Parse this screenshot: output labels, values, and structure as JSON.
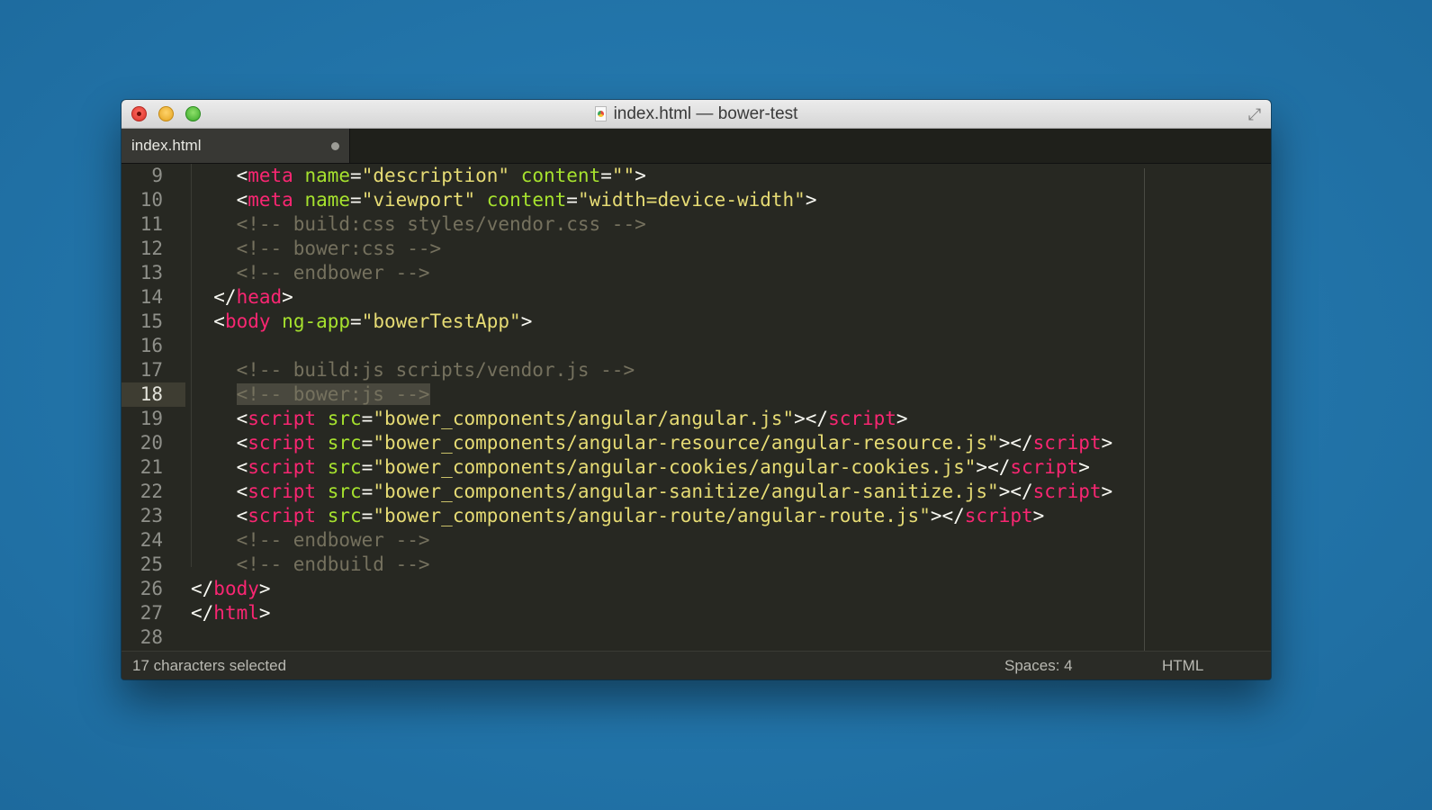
{
  "window": {
    "title": "index.html — bower-test"
  },
  "tabs": [
    {
      "label": "index.html",
      "modified": true
    }
  ],
  "editor": {
    "active_line": 18,
    "lines": [
      {
        "n": "9",
        "tokens": [
          [
            "p",
            "    <"
          ],
          [
            "t",
            "meta"
          ],
          [
            "p",
            " "
          ],
          [
            "a",
            "name"
          ],
          [
            "p",
            "="
          ],
          [
            "s",
            "\"description\""
          ],
          [
            "p",
            " "
          ],
          [
            "a",
            "content"
          ],
          [
            "p",
            "="
          ],
          [
            "s",
            "\"\""
          ],
          [
            "p",
            ">"
          ]
        ]
      },
      {
        "n": "10",
        "tokens": [
          [
            "p",
            "    <"
          ],
          [
            "t",
            "meta"
          ],
          [
            "p",
            " "
          ],
          [
            "a",
            "name"
          ],
          [
            "p",
            "="
          ],
          [
            "s",
            "\"viewport\""
          ],
          [
            "p",
            " "
          ],
          [
            "a",
            "content"
          ],
          [
            "p",
            "="
          ],
          [
            "s",
            "\"width=device-width\""
          ],
          [
            "p",
            ">"
          ]
        ]
      },
      {
        "n": "11",
        "tokens": [
          [
            "p",
            "    "
          ],
          [
            "c",
            "<!-- build:css styles/vendor.css -->"
          ]
        ]
      },
      {
        "n": "12",
        "tokens": [
          [
            "p",
            "    "
          ],
          [
            "c",
            "<!-- bower:css -->"
          ]
        ]
      },
      {
        "n": "13",
        "tokens": [
          [
            "p",
            "    "
          ],
          [
            "c",
            "<!-- endbower -->"
          ]
        ]
      },
      {
        "n": "14",
        "tokens": [
          [
            "p",
            "  </"
          ],
          [
            "t",
            "head"
          ],
          [
            "p",
            ">"
          ]
        ]
      },
      {
        "n": "15",
        "tokens": [
          [
            "p",
            "  <"
          ],
          [
            "t",
            "body"
          ],
          [
            "p",
            " "
          ],
          [
            "a",
            "ng-app"
          ],
          [
            "p",
            "="
          ],
          [
            "s",
            "\"bowerTestApp\""
          ],
          [
            "p",
            ">"
          ]
        ]
      },
      {
        "n": "16",
        "tokens": []
      },
      {
        "n": "17",
        "tokens": [
          [
            "p",
            "    "
          ],
          [
            "c",
            "<!-- build:js scripts/vendor.js -->"
          ]
        ]
      },
      {
        "n": "18",
        "tokens": [
          [
            "p",
            "    "
          ],
          [
            "x",
            "<!-- bower:js -->"
          ]
        ]
      },
      {
        "n": "19",
        "tokens": [
          [
            "p",
            "    <"
          ],
          [
            "t",
            "script"
          ],
          [
            "p",
            " "
          ],
          [
            "a",
            "src"
          ],
          [
            "p",
            "="
          ],
          [
            "s",
            "\"bower_components/angular/angular.js\""
          ],
          [
            "p",
            "></"
          ],
          [
            "t",
            "script"
          ],
          [
            "p",
            ">"
          ]
        ]
      },
      {
        "n": "20",
        "tokens": [
          [
            "p",
            "    <"
          ],
          [
            "t",
            "script"
          ],
          [
            "p",
            " "
          ],
          [
            "a",
            "src"
          ],
          [
            "p",
            "="
          ],
          [
            "s",
            "\"bower_components/angular-resource/angular-resource.js\""
          ],
          [
            "p",
            "></"
          ],
          [
            "t",
            "script"
          ],
          [
            "p",
            ">"
          ]
        ]
      },
      {
        "n": "21",
        "tokens": [
          [
            "p",
            "    <"
          ],
          [
            "t",
            "script"
          ],
          [
            "p",
            " "
          ],
          [
            "a",
            "src"
          ],
          [
            "p",
            "="
          ],
          [
            "s",
            "\"bower_components/angular-cookies/angular-cookies.js\""
          ],
          [
            "p",
            "></"
          ],
          [
            "t",
            "script"
          ],
          [
            "p",
            ">"
          ]
        ]
      },
      {
        "n": "22",
        "tokens": [
          [
            "p",
            "    <"
          ],
          [
            "t",
            "script"
          ],
          [
            "p",
            " "
          ],
          [
            "a",
            "src"
          ],
          [
            "p",
            "="
          ],
          [
            "s",
            "\"bower_components/angular-sanitize/angular-sanitize.js\""
          ],
          [
            "p",
            "></"
          ],
          [
            "t",
            "script"
          ],
          [
            "p",
            ">"
          ]
        ]
      },
      {
        "n": "23",
        "tokens": [
          [
            "p",
            "    <"
          ],
          [
            "t",
            "script"
          ],
          [
            "p",
            " "
          ],
          [
            "a",
            "src"
          ],
          [
            "p",
            "="
          ],
          [
            "s",
            "\"bower_components/angular-route/angular-route.js\""
          ],
          [
            "p",
            "></"
          ],
          [
            "t",
            "script"
          ],
          [
            "p",
            ">"
          ]
        ]
      },
      {
        "n": "24",
        "tokens": [
          [
            "p",
            "    "
          ],
          [
            "c",
            "<!-- endbower -->"
          ]
        ]
      },
      {
        "n": "25",
        "tokens": [
          [
            "p",
            "    "
          ],
          [
            "c",
            "<!-- endbuild -->"
          ]
        ]
      },
      {
        "n": "26",
        "tokens": [
          [
            "p",
            "</"
          ],
          [
            "t",
            "body"
          ],
          [
            "p",
            ">"
          ]
        ]
      },
      {
        "n": "27",
        "tokens": [
          [
            "p",
            "</"
          ],
          [
            "t",
            "html"
          ],
          [
            "p",
            ">"
          ]
        ]
      },
      {
        "n": "28",
        "tokens": []
      }
    ]
  },
  "statusbar": {
    "selection": "17 characters selected",
    "indentation": "Spaces: 4",
    "syntax": "HTML"
  },
  "colors": {
    "tag": "#f92672",
    "attribute": "#a6e22e",
    "string": "#e6db74",
    "comment": "#75715e",
    "text": "#f8f8f2",
    "background": "#272822"
  }
}
